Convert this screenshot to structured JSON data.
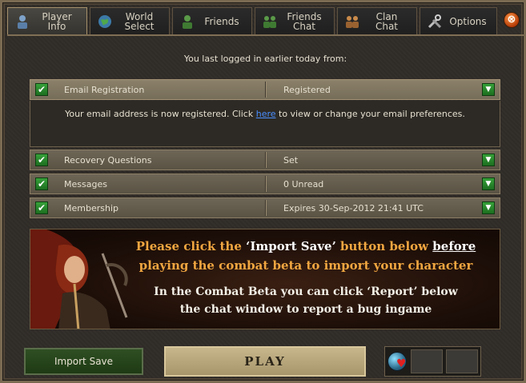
{
  "tabs": [
    {
      "label": "Player\nInfo",
      "icon": "player-info-icon",
      "active": true
    },
    {
      "label": "World\nSelect",
      "icon": "globe-icon",
      "active": false
    },
    {
      "label": "Friends",
      "icon": "friends-icon",
      "active": false
    },
    {
      "label": "Friends\nChat",
      "icon": "friends-chat-icon",
      "active": false
    },
    {
      "label": "Clan\nChat",
      "icon": "clan-chat-icon",
      "active": false
    },
    {
      "label": "Options",
      "icon": "tools-icon",
      "active": false
    }
  ],
  "close_glyph": "⊗",
  "last_login": "You last logged in earlier today from:",
  "rows": [
    {
      "label": "Email Registration",
      "value": "Registered"
    },
    {
      "label": "Recovery Questions",
      "value": "Set"
    },
    {
      "label": "Messages",
      "value": "0 Unread"
    },
    {
      "label": "Membership",
      "value": "Expires 30-Sep-2012 21:41 UTC"
    }
  ],
  "email_detail": {
    "before": "Your email address is now registered. Click ",
    "link": "here",
    "after": " to view or change your email preferences."
  },
  "banner": {
    "l1_a": "Please click the ",
    "l1_b": "‘Import Save’",
    "l1_c": " button below ",
    "l1_d": "before",
    "l2": "playing the combat beta to import your character",
    "l3": "In the Combat Beta you can click ‘Report’ below",
    "l4": "the chat window to report a bug ingame"
  },
  "buttons": {
    "import_save": "Import Save",
    "play": "Play"
  },
  "colors": {
    "accent_orange": "#f0a640",
    "check_green": "#2e8f30",
    "link_blue": "#4a8fff"
  }
}
